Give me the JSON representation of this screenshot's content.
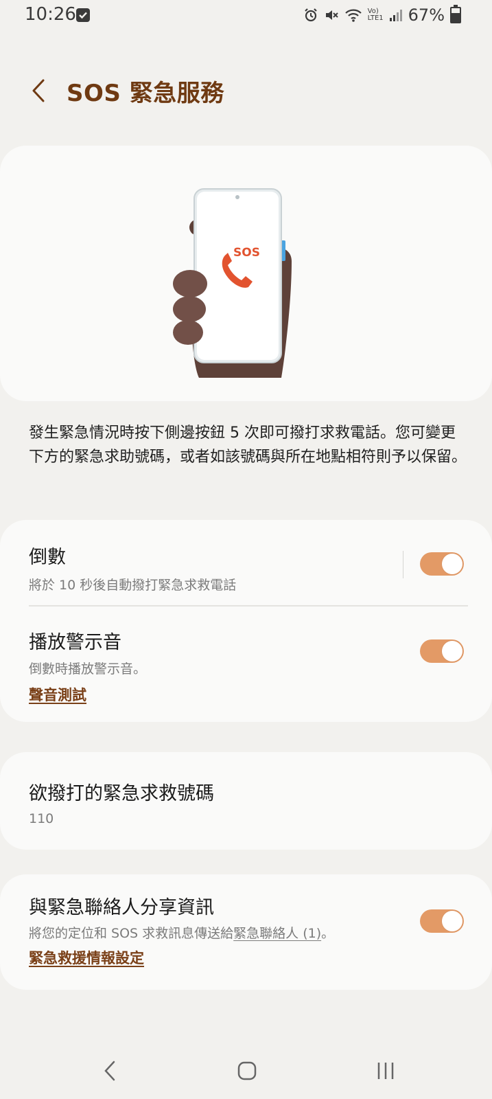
{
  "status_bar": {
    "time": "10:26",
    "battery": "67%",
    "icons": [
      "check-notification-icon",
      "alarm-icon",
      "mute-icon",
      "wifi-icon",
      "volte-lte-icon",
      "signal-icon",
      "battery-icon"
    ],
    "lte_label": "LTE1",
    "volte_label": "Vo)"
  },
  "header": {
    "title": "SOS 緊急服務"
  },
  "illustration": {
    "sos_label": "SOS"
  },
  "description": "發生緊急情況時按下側邊按鈕 5 次即可撥打求救電話。您可變更下方的緊急求助號碼，或者如該號碼與所在地點相符則予以保留。",
  "settings": {
    "countdown": {
      "title": "倒數",
      "subtitle": "將於 10 秒後自動撥打緊急求救電話",
      "enabled": true
    },
    "alarm": {
      "title": "播放警示音",
      "subtitle": "倒數時播放警示音。",
      "link": "聲音測試",
      "enabled": true
    },
    "emergency_number": {
      "title": "欲撥打的緊急求救號碼",
      "value": "110"
    },
    "share_info": {
      "title": "與緊急聯絡人分享資訊",
      "subtitle_prefix": "將您的定位和 SOS 求救訊息傳送給",
      "subtitle_link": "緊急聯絡人 (1)",
      "subtitle_suffix": "。",
      "link": "緊急救援情報設定",
      "enabled": true
    }
  },
  "colors": {
    "accent": "#e39a66",
    "title": "#6f3a12",
    "link": "#7a4018",
    "background": "#f2f1ee",
    "card": "#fafaf9"
  }
}
